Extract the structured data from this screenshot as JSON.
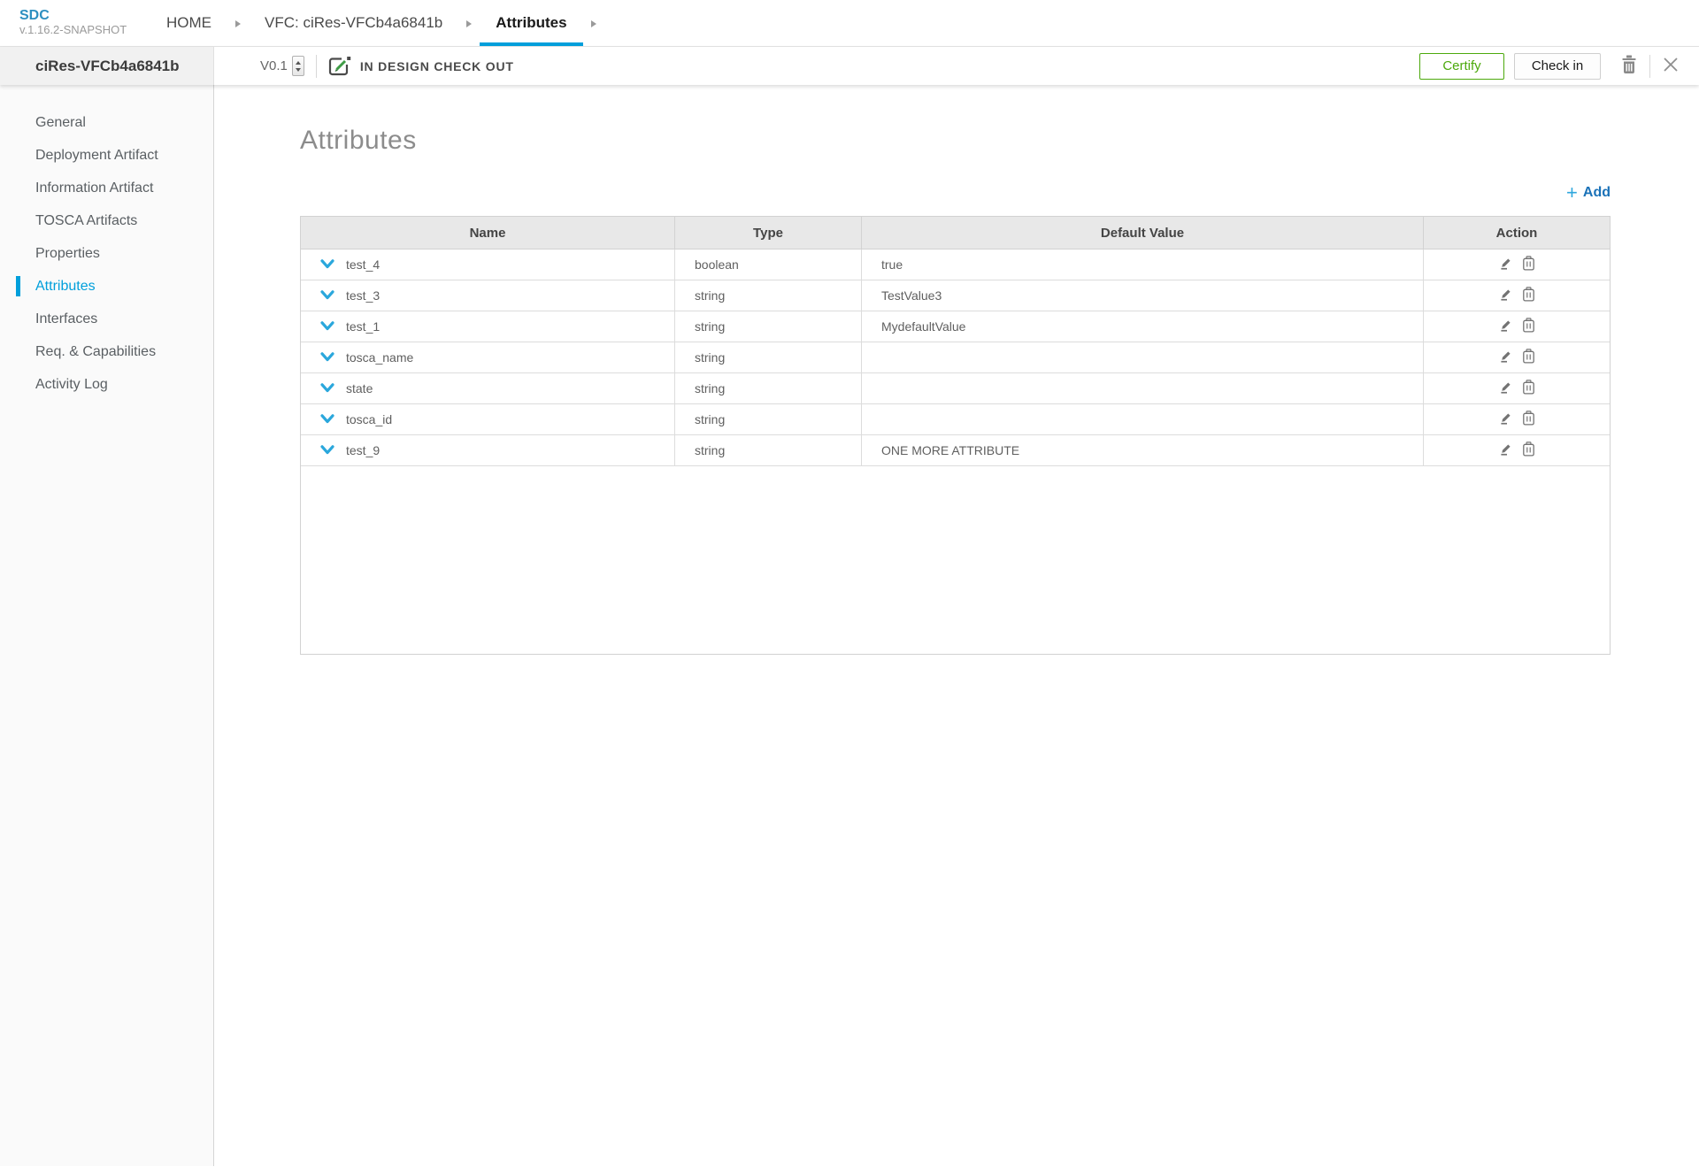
{
  "app": {
    "name": "SDC",
    "version": "v.1.16.2-SNAPSHOT"
  },
  "breadcrumb": {
    "tabs": [
      {
        "label": "HOME",
        "active": false
      },
      {
        "label": "VFC: ciRes-VFCb4a6841b",
        "active": false
      },
      {
        "label": "Attributes",
        "active": true
      }
    ]
  },
  "header": {
    "entity_name": "ciRes-VFCb4a6841b",
    "version": "V0.1",
    "lifecycle_status": "IN DESIGN CHECK OUT",
    "buttons": {
      "certify": "Certify",
      "check_in": "Check in"
    },
    "icons": [
      "checkout-icon",
      "trash-icon",
      "close-icon"
    ]
  },
  "sidebar": {
    "items": [
      {
        "label": "General",
        "active": false
      },
      {
        "label": "Deployment Artifact",
        "active": false
      },
      {
        "label": "Information Artifact",
        "active": false
      },
      {
        "label": "TOSCA Artifacts",
        "active": false
      },
      {
        "label": "Properties",
        "active": false
      },
      {
        "label": "Attributes",
        "active": true
      },
      {
        "label": "Interfaces",
        "active": false
      },
      {
        "label": "Req. & Capabilities",
        "active": false
      },
      {
        "label": "Activity Log",
        "active": false
      }
    ]
  },
  "main": {
    "title": "Attributes",
    "add_button": {
      "plus": "+",
      "label": "Add"
    },
    "table": {
      "columns": [
        "Name",
        "Type",
        "Default Value",
        "Action"
      ],
      "row_icons": [
        "chevron-down-icon",
        "edit-icon",
        "delete-icon"
      ],
      "rows": [
        {
          "name": "test_4",
          "type": "boolean",
          "default_value": "true"
        },
        {
          "name": "test_3",
          "type": "string",
          "default_value": "TestValue3"
        },
        {
          "name": "test_1",
          "type": "string",
          "default_value": "MydefaultValue"
        },
        {
          "name": "tosca_name",
          "type": "string",
          "default_value": ""
        },
        {
          "name": "state",
          "type": "string",
          "default_value": ""
        },
        {
          "name": "tosca_id",
          "type": "string",
          "default_value": ""
        },
        {
          "name": "test_9",
          "type": "string",
          "default_value": "ONE MORE ATTRIBUTE"
        }
      ]
    }
  },
  "colors": {
    "accent": "#009fdb",
    "logo_blue": "#2d8fc0",
    "add_blue": "#1b72b8",
    "plus_blue": "#2fa7dd",
    "certify_green": "#4ca90c",
    "chevron_blue": "#2aa7dc"
  }
}
